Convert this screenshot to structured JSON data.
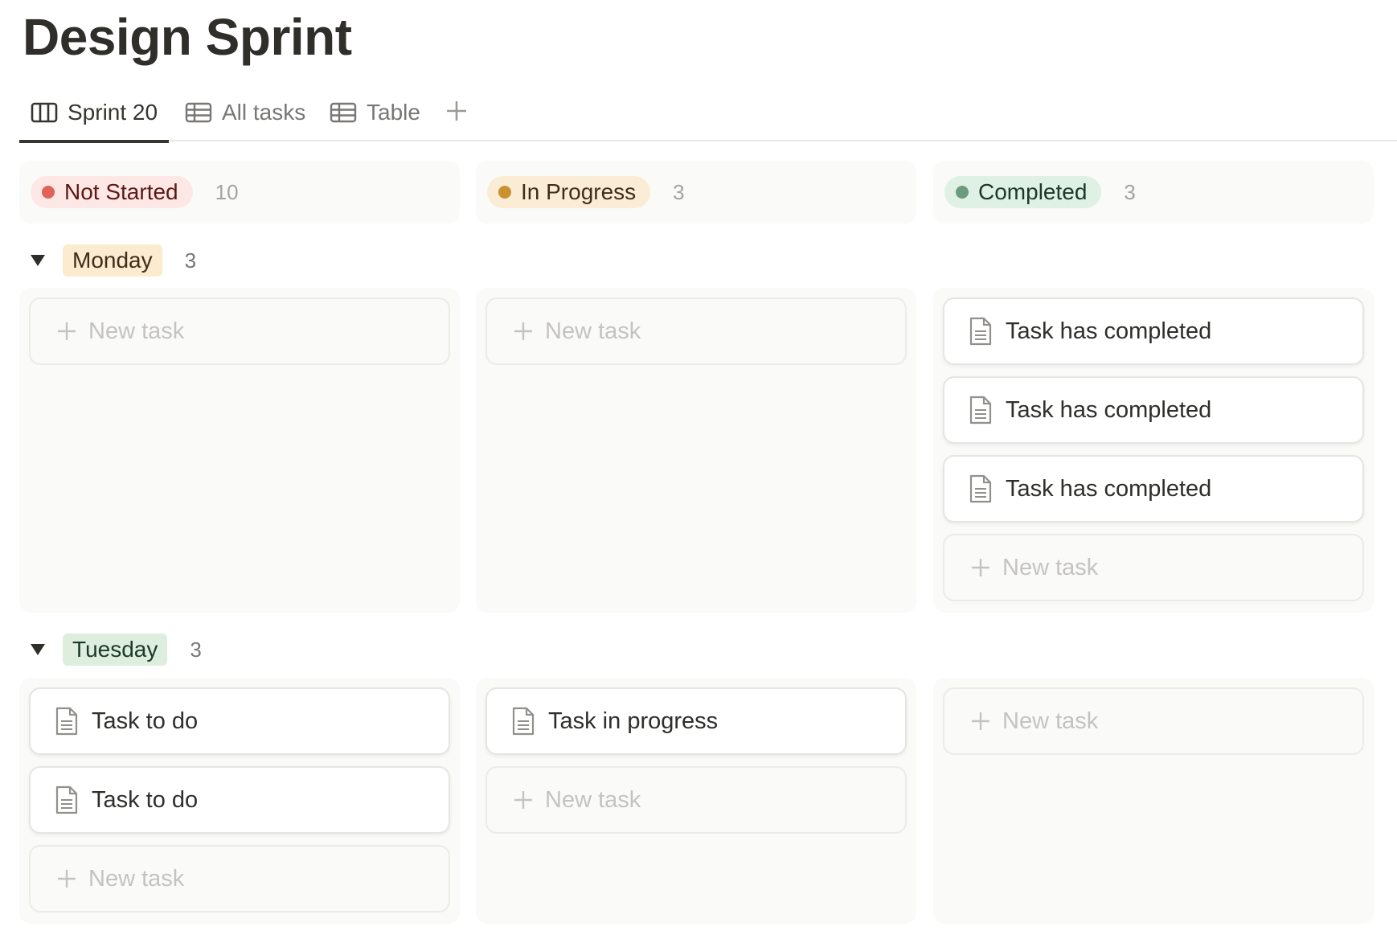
{
  "page": {
    "title": "Design Sprint"
  },
  "tabs": [
    {
      "label": "Sprint 20",
      "icon": "board-icon",
      "active": true
    },
    {
      "label": "All tasks",
      "icon": "table-icon",
      "active": false
    },
    {
      "label": "Table",
      "icon": "table-icon",
      "active": false
    }
  ],
  "columns": [
    {
      "status": "Not Started",
      "count": "10",
      "dot_color": "#e16259",
      "pill_bg": "#fde8e6"
    },
    {
      "status": "In Progress",
      "count": "3",
      "dot_color": "#cb912f",
      "pill_bg": "#fbedd5"
    },
    {
      "status": "Completed",
      "count": "3",
      "dot_color": "#6c9b7d",
      "pill_bg": "#dff0e4"
    }
  ],
  "groups": [
    {
      "label": "Monday",
      "count": "3",
      "tag_color": "#fbecd0",
      "lanes": [
        {
          "cards": [],
          "new_label": "New task"
        },
        {
          "cards": [],
          "new_label": "New task"
        },
        {
          "cards": [
            "Task has completed",
            "Task has completed",
            "Task has completed"
          ],
          "new_label": "New task"
        }
      ]
    },
    {
      "label": "Tuesday",
      "count": "3",
      "tag_color": "#ddeedf",
      "lanes": [
        {
          "cards": [
            "Task to do",
            "Task to do"
          ],
          "new_label": "New task"
        },
        {
          "cards": [
            "Task in progress"
          ],
          "new_label": "New task"
        },
        {
          "cards": [],
          "new_label": "New task"
        }
      ]
    }
  ]
}
